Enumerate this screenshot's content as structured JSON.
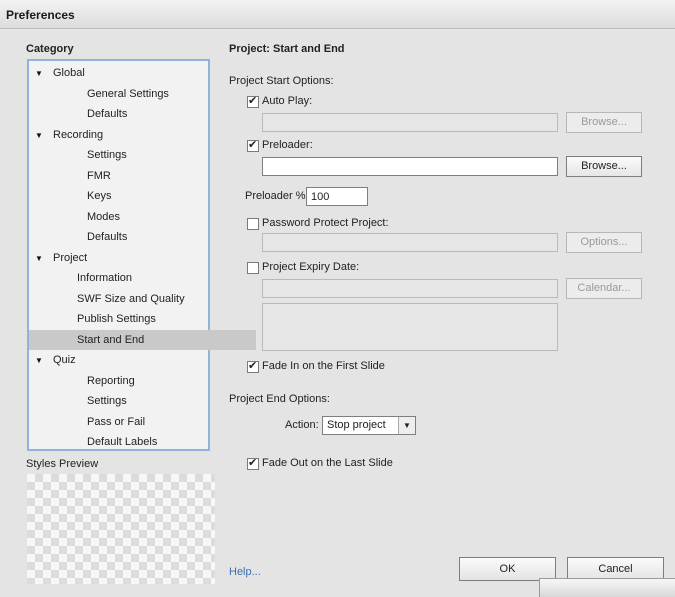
{
  "window": {
    "title": "Preferences"
  },
  "sidebar": {
    "category_label": "Category",
    "styles_preview_label": "Styles Preview",
    "tree": [
      {
        "label": "Global",
        "group": true
      },
      {
        "label": "General Settings"
      },
      {
        "label": "Defaults"
      },
      {
        "label": "Recording",
        "group": true
      },
      {
        "label": "Settings"
      },
      {
        "label": "FMR"
      },
      {
        "label": "Keys"
      },
      {
        "label": "Modes"
      },
      {
        "label": "Defaults"
      },
      {
        "label": "Project",
        "group": true
      },
      {
        "label": "Information"
      },
      {
        "label": "SWF Size and Quality"
      },
      {
        "label": "Publish Settings"
      },
      {
        "label": "Start and End",
        "selected": true
      },
      {
        "label": "Quiz",
        "group": true
      },
      {
        "label": "Reporting"
      },
      {
        "label": "Settings"
      },
      {
        "label": "Pass or Fail"
      },
      {
        "label": "Default Labels"
      }
    ]
  },
  "main": {
    "title": "Project: Start and End",
    "start_options_label": "Project Start Options:",
    "auto_play": {
      "label": "Auto Play:",
      "checked": true,
      "value": "",
      "browse": "Browse..."
    },
    "preloader": {
      "label": "Preloader:",
      "checked": true,
      "value": "",
      "browse": "Browse..."
    },
    "preloader_pct": {
      "label": "Preloader %:",
      "value": "100"
    },
    "password": {
      "label": "Password Protect Project:",
      "checked": false,
      "value": "",
      "button": "Options..."
    },
    "expiry": {
      "label": "Project Expiry Date:",
      "checked": false,
      "value": "",
      "button": "Calendar..."
    },
    "fade_in": {
      "label": "Fade In on the First Slide",
      "checked": true
    },
    "end_options_label": "Project End Options:",
    "action": {
      "label": "Action:",
      "value": "Stop project"
    },
    "fade_out": {
      "label": "Fade Out on the Last Slide",
      "checked": true
    }
  },
  "footer": {
    "help": "Help...",
    "ok": "OK",
    "cancel": "Cancel"
  }
}
